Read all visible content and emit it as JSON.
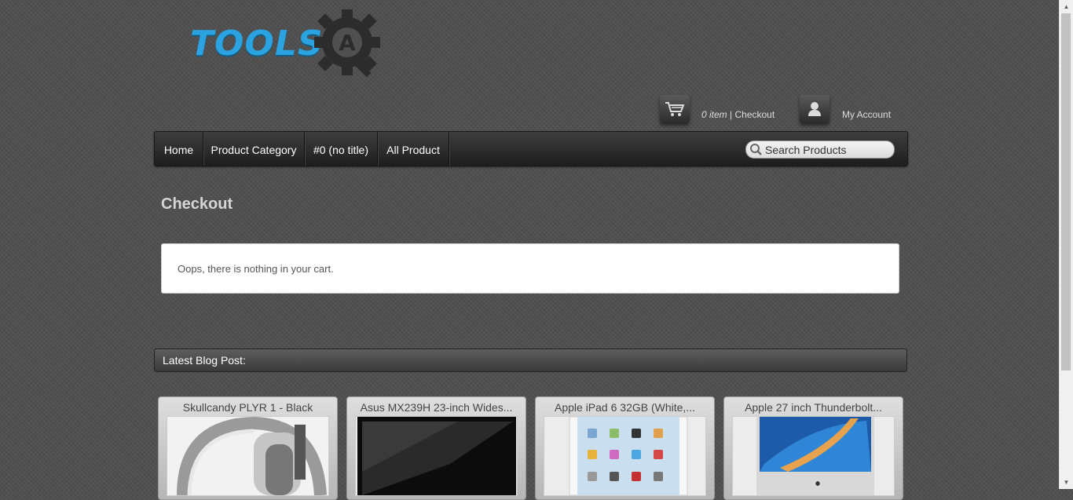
{
  "logo": {
    "text": "TOOLS",
    "gear_letter": "A"
  },
  "header": {
    "cart": {
      "count_text": "0 item",
      "separator": " | ",
      "checkout_label": "Checkout"
    },
    "account_label": "My Account"
  },
  "nav": {
    "items": [
      {
        "label": "Home"
      },
      {
        "label": "Product Category"
      },
      {
        "label": "#0 (no title)"
      },
      {
        "label": "All Product"
      }
    ],
    "search_placeholder": "Search Products"
  },
  "main": {
    "title": "Checkout",
    "notice": "Oops, there is nothing in your cart."
  },
  "blog": {
    "heading": "Latest Blog Post:",
    "products": [
      {
        "name": "Skullcandy PLYR 1 - Black"
      },
      {
        "name": "Asus MX239H 23-inch Wides..."
      },
      {
        "name": "Apple iPad 6 32GB (White,..."
      },
      {
        "name": "Apple 27 inch Thunderbolt..."
      }
    ]
  },
  "colors": {
    "logo_blue": "#2aa3e0",
    "background": "#4f4f4f",
    "nav_dark": "#1e1e1e"
  }
}
